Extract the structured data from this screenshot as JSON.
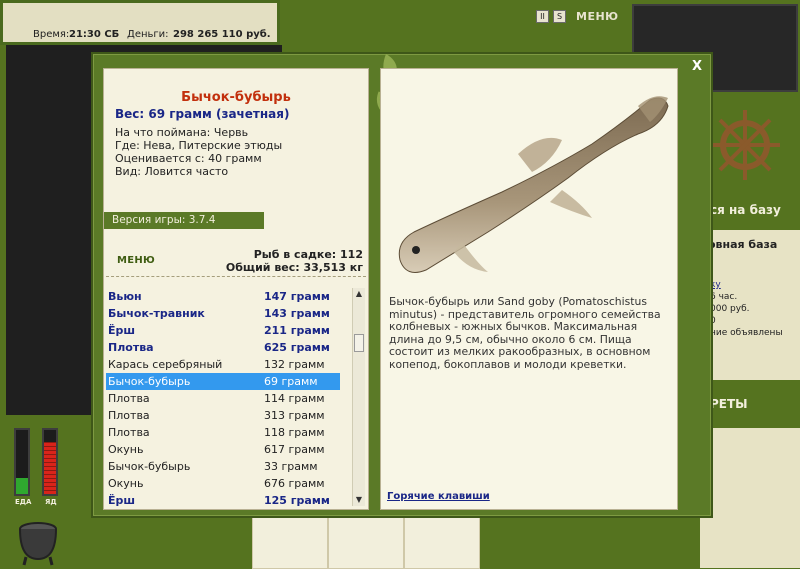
{
  "topbar": {
    "time_label": "Время:",
    "time_value": "21:30 СБ",
    "money_label": "Деньги:",
    "money_value": "298 265 110 руб."
  },
  "top_buttons": {
    "pause": "II",
    "sound": "S",
    "menu": "МЕНЮ"
  },
  "meters": {
    "food_label": "ЕДА",
    "poison_label": "ЯД",
    "food_level": 0.25,
    "poison_level": 0.82,
    "food_color": "#2fa82f",
    "poison_color": "#d8241a"
  },
  "right_panel": {
    "go_to_base": "ся на базу",
    "base_title": "овная база",
    "link_text": "ку",
    "line1": "6 час.",
    "line2": "000 руб.",
    "line3": "0",
    "line4": "ние объявлены",
    "secrets": "РЕТЫ"
  },
  "modal": {
    "close": "X",
    "fish_name": "Бычок-бубырь",
    "weight": "Вес: 69 грамм (зачетная)",
    "caught_on": "На что поймана: Червь",
    "where": "Где: Нева, Питерские этюды",
    "valued_from": "Оценивается с: 40 грамм",
    "species": "Вид: Ловится часто",
    "version": "Версия игры: 3.7.4",
    "menu": "МЕНЮ",
    "fish_in_net": "Рыб в садке: 112",
    "total_weight": "Общий вес: 33,513 кг",
    "description": "Бычок-бубырь или Sand goby (Pomatoschistus minutus) - представитель огромного семейства колбневых - южных бычков. Максимальная длина до 9,5 см, обычно около 6 см. Пища состоит из мелких ракообразных, в основном копепод, бокоплавов и молоди креветки.",
    "hotkeys": "Горячие клавиши",
    "list": [
      {
        "name": "Вьюн",
        "weight": "147 грамм",
        "bold": true
      },
      {
        "name": "Бычок-травник",
        "weight": "143 грамм",
        "bold": true
      },
      {
        "name": "Ёрш",
        "weight": "211 грамм",
        "bold": true
      },
      {
        "name": "Плотва",
        "weight": "625 грамм",
        "bold": true
      },
      {
        "name": "Карась серебряный",
        "weight": "132 грамм",
        "bold": false
      },
      {
        "name": "Бычок-бубырь",
        "weight": "69 грамм",
        "bold": false,
        "selected": true
      },
      {
        "name": "Плотва",
        "weight": "114 грамм",
        "bold": false
      },
      {
        "name": "Плотва",
        "weight": "313 грамм",
        "bold": false
      },
      {
        "name": "Плотва",
        "weight": "118 грамм",
        "bold": false
      },
      {
        "name": "Окунь",
        "weight": "617 грамм",
        "bold": false
      },
      {
        "name": "Бычок-бубырь",
        "weight": "33 грамм",
        "bold": false
      },
      {
        "name": "Окунь",
        "weight": "676 грамм",
        "bold": false
      },
      {
        "name": "Ёрш",
        "weight": "125 грамм",
        "bold": true
      }
    ]
  }
}
